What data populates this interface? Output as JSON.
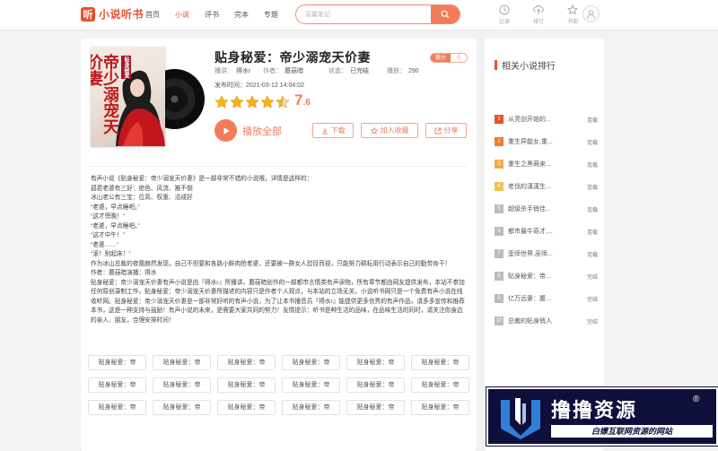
{
  "site": {
    "logo_mark": "听",
    "logo_text": "小说听书"
  },
  "nav": [
    {
      "label": "首页",
      "active": false
    },
    {
      "label": "小说",
      "active": true
    },
    {
      "label": "评书",
      "active": false
    },
    {
      "label": "完本",
      "active": false
    },
    {
      "label": "专题",
      "active": false
    }
  ],
  "search": {
    "placeholder": "温馨笔记"
  },
  "tools": [
    {
      "label": "记录",
      "icon": "clock-icon"
    },
    {
      "label": "排行",
      "icon": "upload-icon"
    },
    {
      "label": "书架",
      "icon": "star-icon"
    }
  ],
  "book": {
    "title": "贴身秘爱：帝少溺宠天价妻",
    "badge_left": "趣分",
    "badge_right": "0",
    "cover_title": "帝少溺宠天价妻",
    "cover_sub": "贴身秘爱",
    "meta": [
      {
        "k": "播讲：",
        "v": "得水r"
      },
      {
        "k": "作者：",
        "v": "蘑菇暗"
      },
      {
        "k": "状态：",
        "v": "已完结"
      },
      {
        "k": "播放：",
        "v": "290"
      }
    ],
    "pubtime": "发布时间：2021-03-12 14:04:02",
    "stars": 4.5,
    "score_int": "7",
    "score_dec": ".6",
    "play_label": "播放全部",
    "download_label": "下载",
    "favorite_label": "加入收藏",
    "share_label": "分享",
    "accent": "#f07c5c"
  },
  "description": [
    "有声小说《贴身秘爱：帝少溺宠天价妻》是一部非常不错的小说哦，详情是这样的：",
    "孤君老婆有三好：绝色、风流、推不倒",
    "冰山老公有三宝：位高、权重、活成好",
    "“老婆，早点睡吧。”",
    "“这才傍晚！”",
    "“老婆，早点睡吧。”",
    "“这才中午！”",
    "“老婆……”",
    "“滚！别起床！”",
    "作为冰山总裁的夜凰赫然发现，自己不但要和各路小鲜肉抢老婆，还要被一群女人怼目而视，只能努力耕耘用行动表示自己的勤劳肯干！",
    "作者：蘑菇暗演播：得水",
    "贴身秘爱：帝少溺宠天价妻有声小说是由『得水r』所播讲，蘑菇暗创作的一部都市言情类有声读物，所有章节都由网友提供发布，本站不参加任何原创录制工作，贴身秘爱：帝少溺宠天价妻所描述的内容只是作者个人观点，与本站的立场无关，小说听书网只是一个免费有声小说在线收听网。贴身秘爱：帝少溺宠天价妻是一部非常好听的有声小说，为了让本书播音员『得水r』能提供更多优秀的有声作品，请多多宣传和推荐本书，这是一种支持与鼓励！有声小说的未来，是需要大家共同的努力！友情提示：听书是种生活的品味，在品味生活的同时，请关注你身边的亲人、朋友，合理安排时间！"
  ],
  "tags": [
    "贴身秘爱：帝",
    "贴身秘爱：帝",
    "贴身秘爱：帝",
    "贴身秘爱：帝",
    "贴身秘爱：帝",
    "贴身秘爱：帝",
    "贴身秘爱：帝",
    "贴身秘爱：帝",
    "贴身秘爱：帝",
    "贴身秘爱：帝",
    "贴身秘爱：帝",
    "贴身秘爱：帝",
    "贴身秘爱：帝",
    "贴身秘爱：帝",
    "贴身秘爱：帝",
    "贴身秘爱：帝",
    "贴身秘爱：帝",
    "贴身秘爱：帝"
  ],
  "ranking": {
    "title": "相关小说排行",
    "items": [
      {
        "num": "1",
        "name": "从亮剑开始的...",
        "status": "连载",
        "color": "#e94f2e"
      },
      {
        "num": "2",
        "name": "重生异能女,重...",
        "status": "连载",
        "color": "#f07c2e"
      },
      {
        "num": "3",
        "name": "重生之黑萌来...",
        "status": "连载",
        "color": "#f0a84e"
      },
      {
        "num": "4",
        "name": "老伐的漢漢生...",
        "status": "连载",
        "color": "#f0c24e"
      },
      {
        "num": "5",
        "name": "超级杀手俏佳...",
        "status": "连载",
        "color": "#bbbbbb"
      },
      {
        "num": "6",
        "name": "都市最牛奇才,...",
        "status": "连载",
        "color": "#bbbbbb"
      },
      {
        "num": "7",
        "name": "歪师世界,巫师...",
        "status": "连载",
        "color": "#bbbbbb"
      },
      {
        "num": "8",
        "name": "贴身秘爱：帝...",
        "status": "完结",
        "color": "#bbbbbb"
      },
      {
        "num": "9",
        "name": "亿万远妻：腹...",
        "status": "完结",
        "color": "#bbbbbb"
      },
      {
        "num": "10",
        "name": "总裁的贴身俏人",
        "status": "完结",
        "color": "#bbbbbb"
      }
    ]
  },
  "banner": {
    "title": "撸撸资源",
    "reg": "®",
    "subtitle": "白嫖互联网资源的网站"
  }
}
